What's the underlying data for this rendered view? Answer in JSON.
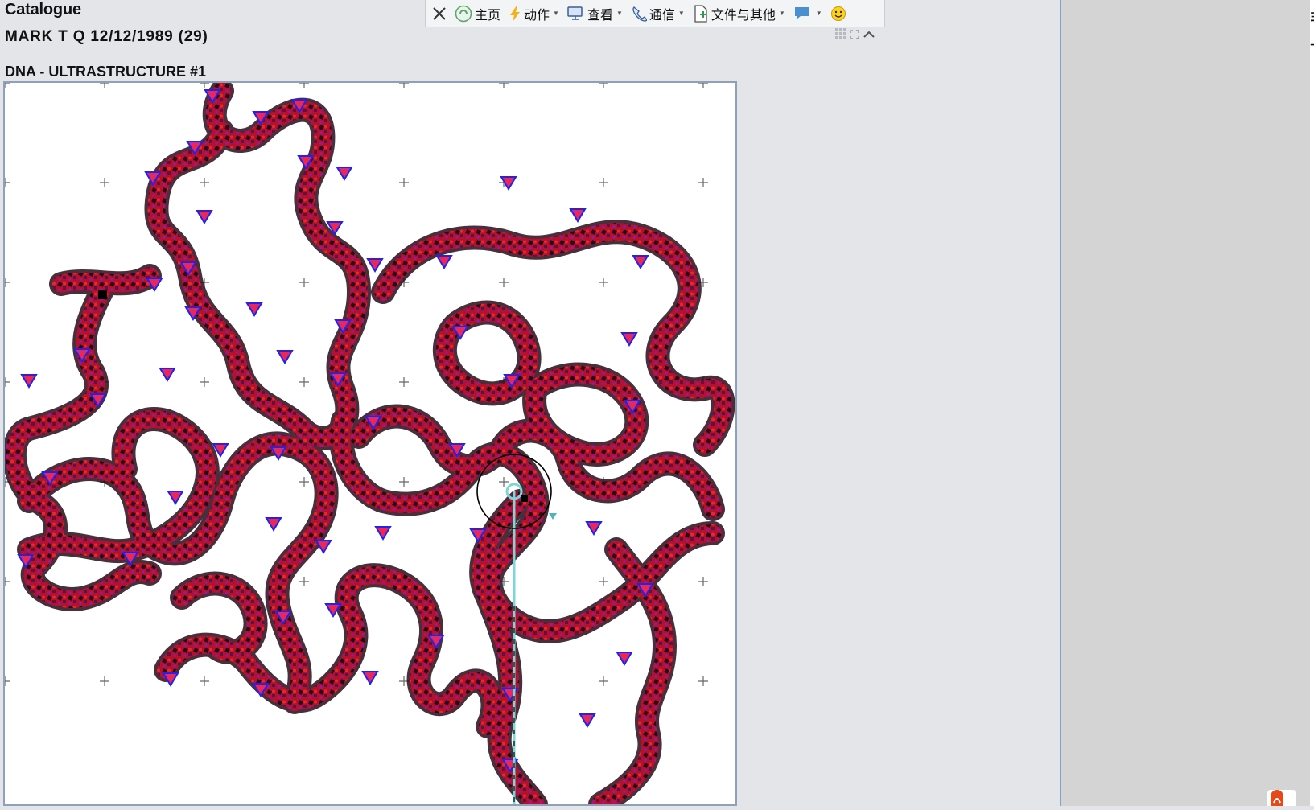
{
  "app": {
    "title": "Catalogue"
  },
  "patient": {
    "info": "MARK T Q 12/12/1989 (29)"
  },
  "view": {
    "title": "DNA - ULTRASTRUCTURE #1"
  },
  "toolbar": {
    "close_icon": "close-icon",
    "items": [
      {
        "label": "主页",
        "icon": "home-icon",
        "dropdown": false
      },
      {
        "label": "动作",
        "icon": "lightning-icon",
        "dropdown": true
      },
      {
        "label": "查看",
        "icon": "monitor-icon",
        "dropdown": true
      },
      {
        "label": "通信",
        "icon": "phone-icon",
        "dropdown": true
      },
      {
        "label": "文件与其他",
        "icon": "file-icon",
        "dropdown": true
      }
    ],
    "chat_icon": "chat-icon",
    "emoji_icon": "smiley-icon"
  },
  "colors": {
    "strand": "#b3112c",
    "strand_dark": "#2a0a1a",
    "marker_fill": "#e8285a",
    "marker_stroke": "#2222ee",
    "cursor_line": "#7fd6d6",
    "panel_border": "#8da1bb",
    "right_panel": "#d4d4d4"
  }
}
